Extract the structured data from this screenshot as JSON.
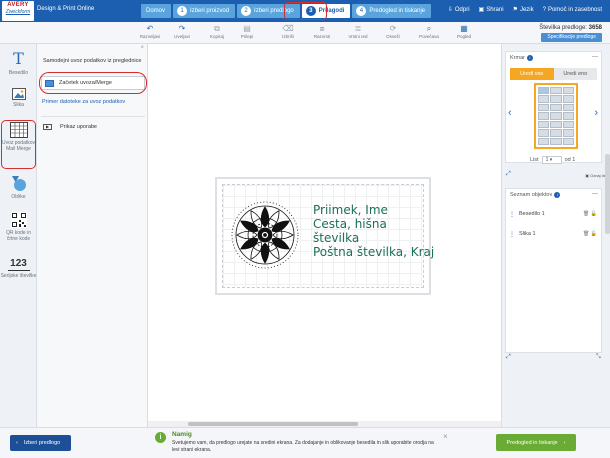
{
  "header": {
    "logo_line1": "AVERY",
    "logo_line2": "Zweckform",
    "app_name": "Design & Print Online",
    "steps": [
      {
        "label": "Domov",
        "num": ""
      },
      {
        "label": "Izberi proizvod",
        "num": "1"
      },
      {
        "label": "Izberi predlogo",
        "num": "2"
      },
      {
        "label": "Prilagodi",
        "num": "3"
      },
      {
        "label": "Predogled in tiskanje",
        "num": "4"
      }
    ],
    "right_links": {
      "open": "Odpri",
      "save": "Shrani",
      "language": "Jezik",
      "help": "Pomoč in zasebnost"
    }
  },
  "toolbar": {
    "tools": [
      {
        "label": "Razveljavi",
        "icon": "undo-icon",
        "glyph": "↶"
      },
      {
        "label": "Uveljavi",
        "icon": "redo-icon",
        "glyph": "↷"
      },
      {
        "label": "Kopiraj",
        "icon": "copy-icon",
        "glyph": "⧉"
      },
      {
        "label": "Prilepi",
        "icon": "paste-icon",
        "glyph": "📋"
      },
      {
        "label": "Izbriši",
        "icon": "trash-icon",
        "glyph": "🗑"
      },
      {
        "label": "Razvrsti",
        "icon": "arrange-icon",
        "glyph": "⧈"
      },
      {
        "label": "Vrstni red",
        "icon": "order-icon",
        "glyph": "≣"
      },
      {
        "label": "Osveži",
        "icon": "refresh-icon",
        "glyph": "⟳"
      },
      {
        "label": "Povečava",
        "icon": "zoom-icon",
        "glyph": "🔍"
      },
      {
        "label": "Pogled",
        "icon": "grid-icon",
        "glyph": "▦"
      }
    ],
    "template_code_label": "Številka predloge:",
    "template_code_value": "3658",
    "specs_button": "Specifikacije predloge"
  },
  "sidebar": {
    "items": [
      {
        "label": "Besedilo",
        "icon": "text-icon"
      },
      {
        "label": "Slika",
        "icon": "image-icon"
      },
      {
        "label": "Uvoz podatkov Mail Merge",
        "icon": "mail-merge-icon"
      },
      {
        "label": "Oblike",
        "icon": "shapes-icon"
      },
      {
        "label": "QR kode in črtne kode",
        "icon": "qr-code-icon"
      },
      {
        "label": "Serijske številke",
        "icon": "serial-number-icon"
      }
    ]
  },
  "panel": {
    "title": "Samodejni uvoz podatkov iz preglednice",
    "merge_button": "Začetek uvoza/Merge",
    "sample_link": "Primer datoteke za uvoz podatkov",
    "video_label": "Prikaz uporabe"
  },
  "label": {
    "lines": [
      "Priimek, Ime",
      "Cesta, hišna",
      "številka",
      "Poštna številka, Kraj"
    ],
    "text_color": "#1d6e5b"
  },
  "right": {
    "frame_title": "Krmar",
    "tab_all": "Uredi vse",
    "tab_one": "Uredi eno",
    "sheet_label": "List",
    "sheet_value": "1",
    "sheet_of": "od 1",
    "shortcut": "Oznaj del",
    "objects_title": "Seznam objektov",
    "objects": [
      {
        "label": "Besedilo 1"
      },
      {
        "label": "Slika 1"
      }
    ]
  },
  "bottom": {
    "prev_button": "Izberi predlogo",
    "tip_title": "Namig",
    "tip_text": "Svetujemo vam, da predlogo urejate na sredini ekrana. Za dodajanje in oblikovanje besedila in slik uporabite orodja na levi strani ekrana.",
    "next_button": "Predogled in tiskanje"
  },
  "colors": {
    "brand": "#1c5fb0",
    "accent": "#f5a623",
    "success": "#6aab35",
    "highlight": "#d32f2f"
  }
}
